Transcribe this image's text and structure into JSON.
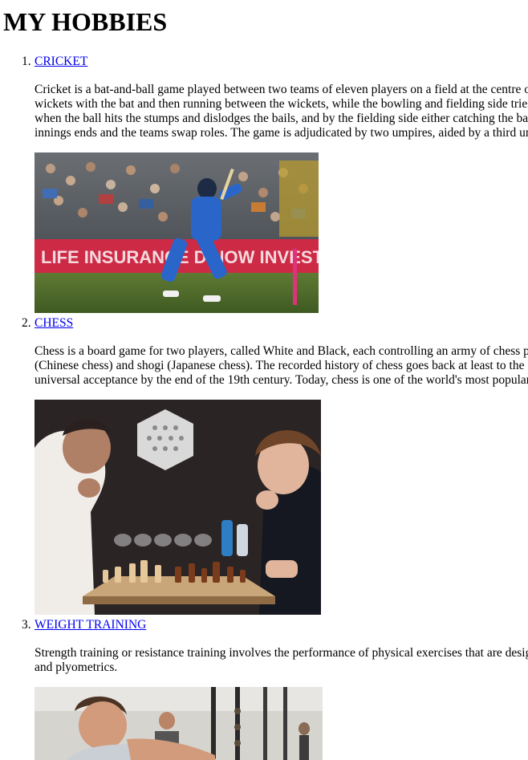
{
  "page": {
    "title": "MY HOBBIES"
  },
  "hobbies": [
    {
      "number": "1.",
      "name": "CRICKET",
      "lines": [
        "Cricket is a bat-and-ball game played between two teams of eleven players on a field at the centre of which",
        "wickets with the bat and then running between the wickets, while the bowling and fielding side tries to",
        "when the ball hits the stumps and dislodges the bails, and by the fielding side either catching the ball",
        "innings ends and the teams swap roles. The game is adjudicated by two umpires, aided by a third umpire"
      ],
      "image_alt": "Batsman in blue kit playing a shot in front of a crowd",
      "image_banner_text": "LIFE INSURANCE    D NOW INVEST"
    },
    {
      "number": "2.",
      "name": "CHESS",
      "lines": [
        "Chess is a board game for two players, called White and Black, each controlling an army of chess pieces",
        "(Chinese chess) and shogi (Japanese chess). The recorded history of chess goes back at least to the emergence",
        "universal acceptance by the end of the 19th century. Today, chess is one of the world's most popular games"
      ],
      "image_alt": "Two players concentrating over a chessboard"
    },
    {
      "number": "3.",
      "name": "WEIGHT TRAINING",
      "lines": [
        "Strength training or resistance training involves the performance of physical exercises that are designed to",
        "and plyometrics."
      ],
      "image_alt": "Man lifting weights in a gym"
    }
  ],
  "colors": {
    "link": "#0000ee",
    "text": "#000000",
    "background": "#ffffff"
  }
}
